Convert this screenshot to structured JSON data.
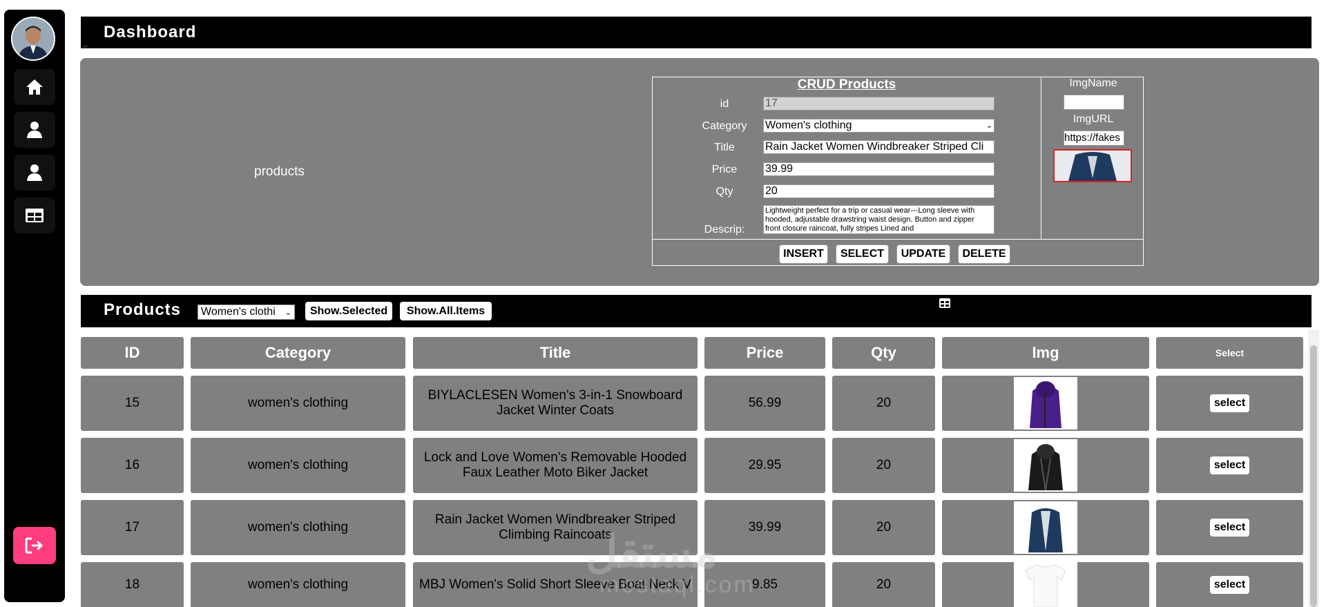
{
  "header": {
    "title": "Dashboard"
  },
  "crud": {
    "left_label": "products",
    "title": "CRUD Products",
    "labels": {
      "id": "id",
      "category": "Category",
      "title": "Title",
      "price": "Price",
      "qty": "Qty",
      "descrip": "Descrip:"
    },
    "values": {
      "id": "17",
      "category": "Women's clothing",
      "title": "Rain Jacket Women Windbreaker Striped Cli",
      "price": "39.99",
      "qty": "20",
      "descrip": "Lightweight perfect for a trip or casual wear---Long sleeve with hooded, adjustable drawstring waist design. Button and zipper front closure raincoat, fully stripes Lined and"
    },
    "img_name_label": "ImgName",
    "img_name_value": "",
    "img_url_label": "ImgURL",
    "img_url_value": "https://fakes",
    "buttons": {
      "insert": "INSERT",
      "select": "SELECT",
      "update": "UPDATE",
      "delete": "DELETE"
    }
  },
  "products_bar": {
    "title": "Products",
    "filter_value": "Women's clothi",
    "show_selected": "Show.Selected",
    "show_all": "Show.All.Items"
  },
  "table": {
    "headers": [
      "ID",
      "Category",
      "Title",
      "Price",
      "Qty",
      "Img",
      "Select"
    ],
    "rows": [
      {
        "id": "15",
        "category": "women's clothing",
        "title": "BIYLACLESEN Women's 3-in-1 Snowboard Jacket Winter Coats",
        "price": "56.99",
        "qty": "20",
        "img": "purple-jacket",
        "select": "select"
      },
      {
        "id": "16",
        "category": "women's clothing",
        "title": "Lock and Love Women's Removable Hooded Faux Leather Moto Biker Jacket",
        "price": "29.95",
        "qty": "20",
        "img": "black-leather-jacket",
        "select": "select"
      },
      {
        "id": "17",
        "category": "women's clothing",
        "title": "Rain Jacket Women Windbreaker Striped Climbing Raincoats",
        "price": "39.99",
        "qty": "20",
        "img": "navy-rain-jacket",
        "select": "select"
      },
      {
        "id": "18",
        "category": "women's clothing",
        "title": "MBJ Women's Solid Short Sleeve Boat Neck V",
        "price": "9.85",
        "qty": "20",
        "img": "white-tshirt",
        "select": "select"
      }
    ]
  },
  "watermark": {
    "text": "مستقل",
    "latin": "mostaql.com"
  },
  "colors": {
    "sidebar": "#000000",
    "panel": "#808080",
    "logout": "#ff3d7f",
    "preview_border": "#e02020"
  },
  "icons": [
    "avatar",
    "home-icon",
    "user-icon",
    "user-icon",
    "table-icon",
    "logout-icon",
    "grid-icon"
  ]
}
